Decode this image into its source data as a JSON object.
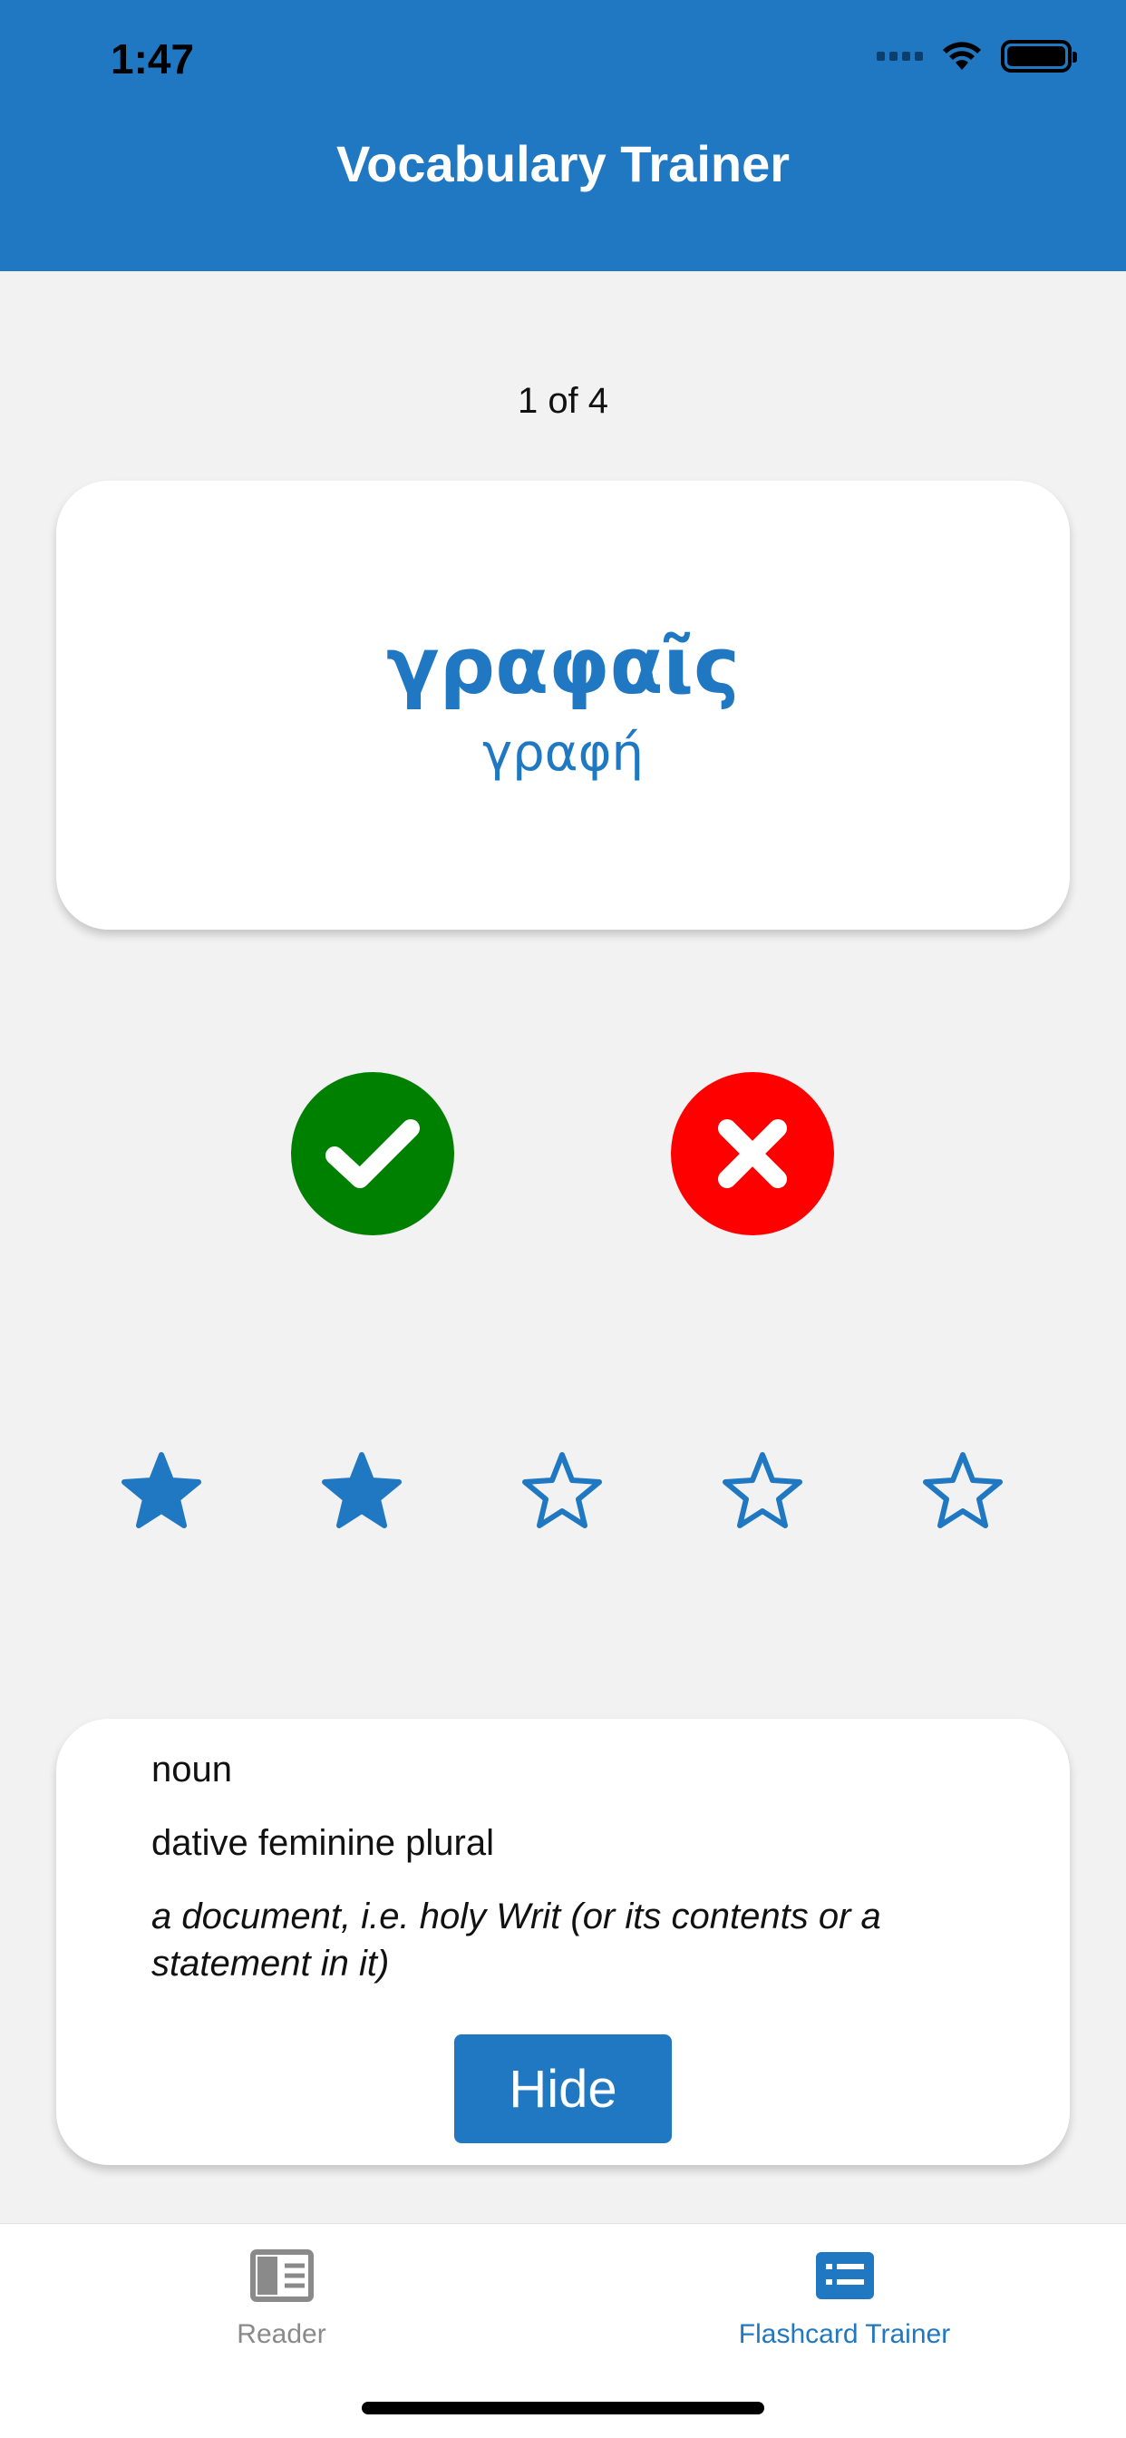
{
  "status_bar": {
    "time": "1:47"
  },
  "header": {
    "title": "Vocabulary Trainer"
  },
  "progress": {
    "counter": "1 of 4",
    "current": 1,
    "total": 4
  },
  "flashcard": {
    "word": "γραφαῖς",
    "lemma": "γραφή"
  },
  "answer_buttons": [
    {
      "name": "correct",
      "icon": "check-icon",
      "color": "#008000"
    },
    {
      "name": "wrong",
      "icon": "close-icon",
      "color": "#ff0000"
    }
  ],
  "rating": {
    "value": 2,
    "max": 5
  },
  "details": {
    "part_of_speech": "noun",
    "parsing": "dative feminine plural",
    "gloss": " a document, i.e. holy Writ (or its contents or a statement in it)",
    "hide_label": "Hide"
  },
  "tabs": [
    {
      "label": "Reader",
      "icon": "reader-icon",
      "active": false
    },
    {
      "label": "Flashcard Trainer",
      "icon": "flashcard-icon",
      "active": true
    }
  ],
  "colors": {
    "accent": "#1f78c1",
    "correct": "#008000",
    "wrong": "#ff0000",
    "background": "#f2f2f2"
  }
}
